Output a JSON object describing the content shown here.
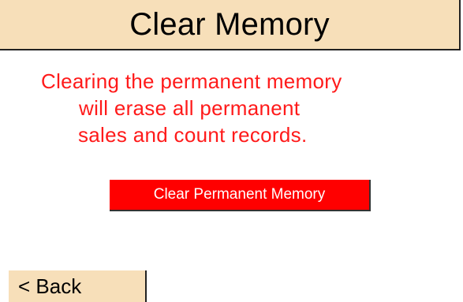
{
  "header": {
    "title": "Clear Memory"
  },
  "warning": {
    "line1": "Clearing the permanent memory",
    "line2": "will erase all permanent",
    "line3": "sales and count records."
  },
  "actions": {
    "clear_label": "Clear Permanent Memory",
    "back_label": "< Back"
  },
  "colors": {
    "header_bg": "#f7dfb9",
    "warning_text": "#ff1a1a",
    "clear_button_bg": "#ff0000",
    "back_button_bg": "#f7dfb9"
  }
}
